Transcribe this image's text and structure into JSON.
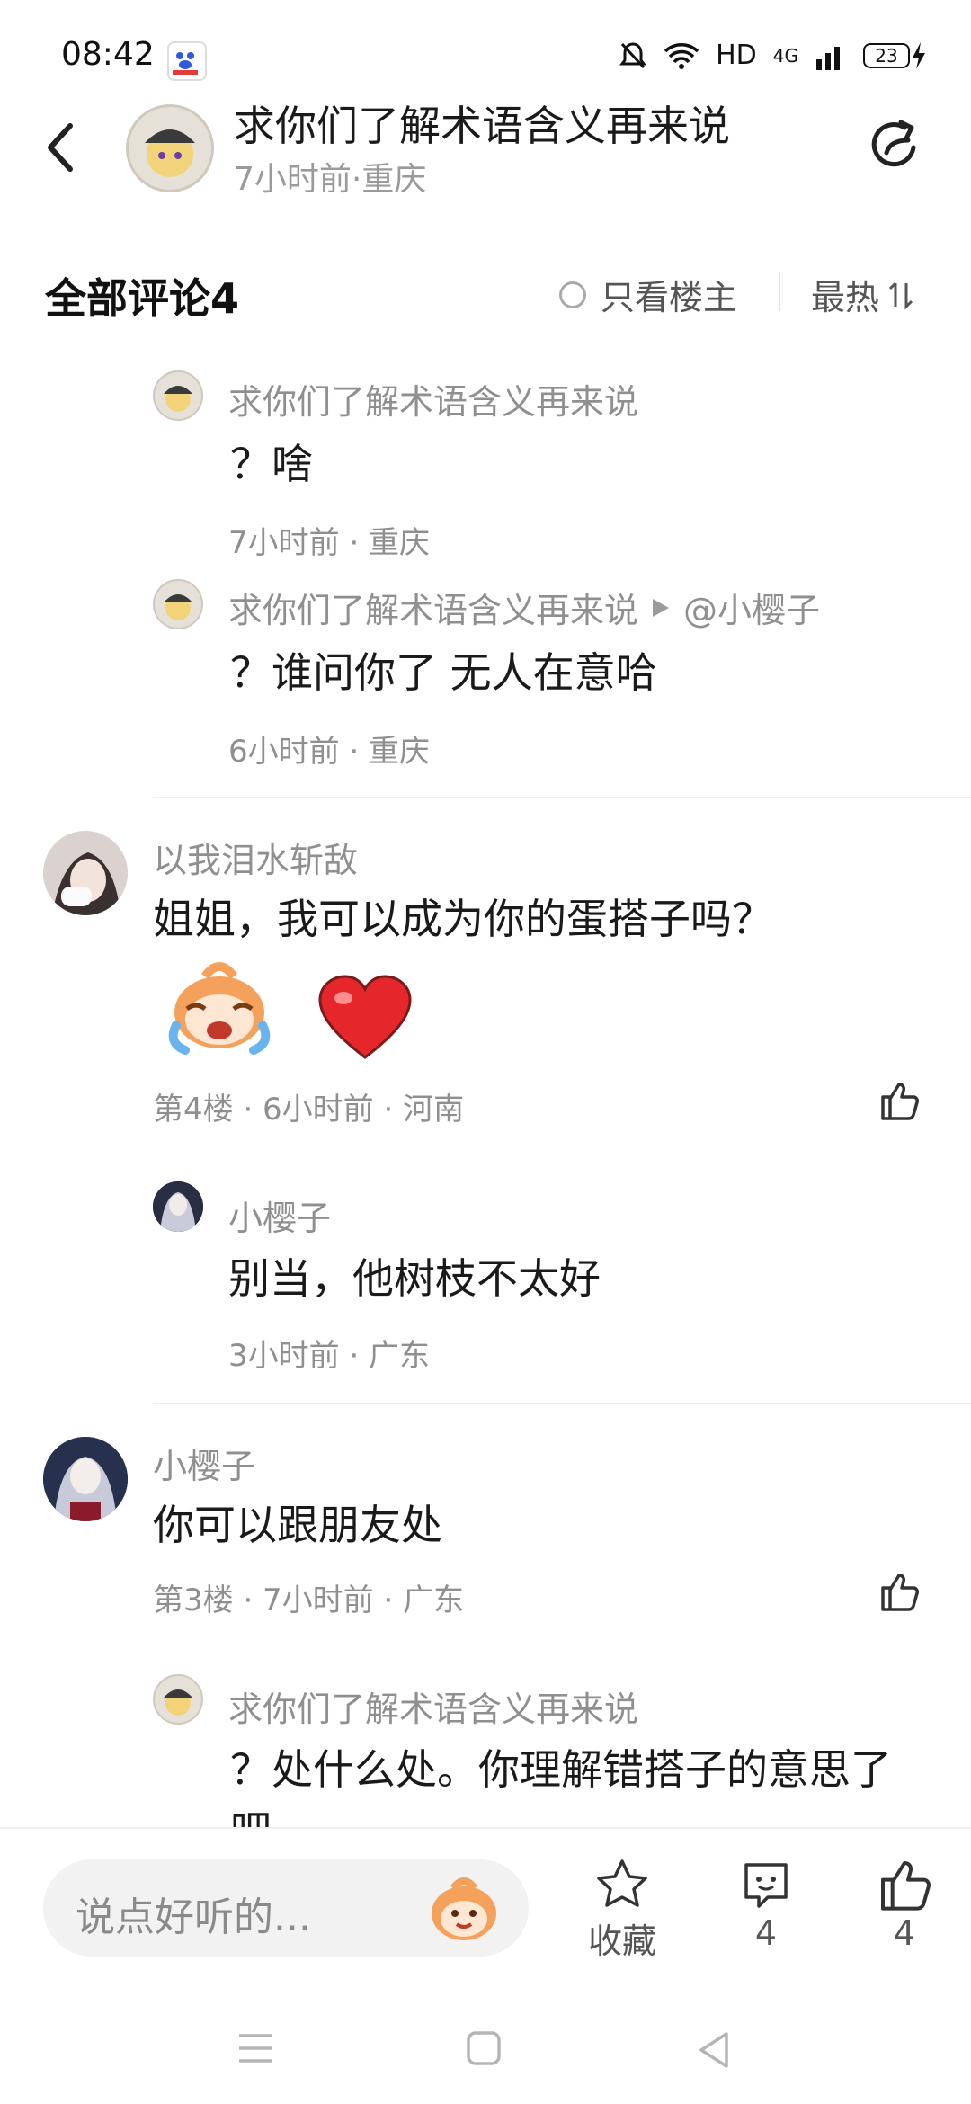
{
  "status": {
    "time": "08:42",
    "network": "HD",
    "signal": "4G",
    "battery": "23"
  },
  "header": {
    "title": "求你们了解术语含义再来说",
    "subtitle": "7小时前·重庆"
  },
  "comments_bar": {
    "title": "全部评论4",
    "filter_label": "只看楼主",
    "sort_label": "最热"
  },
  "thread": [
    {
      "name": "求你们了解术语含义再来说",
      "text": "？啥",
      "meta": "7小时前 · 重庆"
    },
    {
      "name": "求你们了解术语含义再来说",
      "reply_to": "@小樱子",
      "text": "？谁问你了 无人在意哈",
      "meta": "6小时前 · 重庆"
    }
  ],
  "floor4": {
    "name": "以我泪水斩敌",
    "text": "姐姐，我可以成为你的蛋搭子吗？",
    "meta": "第4楼 · 6小时前 · 河南",
    "reply": {
      "name": "小樱子",
      "text": "别当，他树枝不太好",
      "meta": "3小时前 · 广东"
    }
  },
  "floor3": {
    "name": "小樱子",
    "text": "你可以跟朋友处",
    "meta": "第3楼 · 7小时前 · 广东",
    "reply": {
      "name": "求你们了解术语含义再来说",
      "text": "？处什么处。你理解错搭子的意思了",
      "text_cut": "吧"
    }
  },
  "bottom": {
    "placeholder": "说点好听的...",
    "favorite_label": "收藏",
    "comment_count": "4",
    "like_count": "4"
  },
  "colors": {
    "heart": "#e5262b",
    "emoji": "#f4a15c",
    "accent": "#333333"
  }
}
